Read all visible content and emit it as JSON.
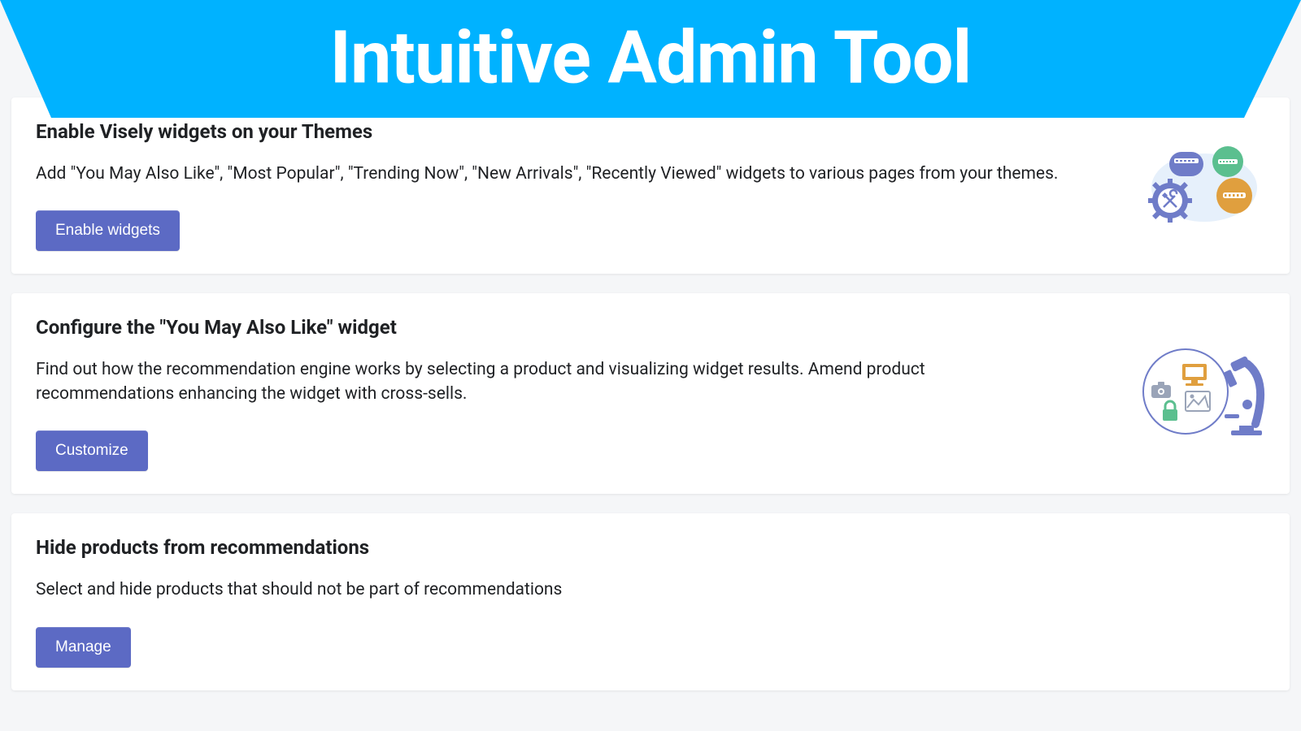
{
  "banner": {
    "title": "Intuitive Admin Tool"
  },
  "cards": [
    {
      "title": "Enable Visely widgets on your Themes",
      "description": "Add \"You May Also Like\", \"Most Popular\", \"Trending Now\", \"New Arrivals\", \"Recently Viewed\" widgets to various pages from your themes.",
      "button": "Enable widgets"
    },
    {
      "title": "Configure the \"You May Also Like\" widget",
      "description": "Find out how the recommendation engine works by selecting a product and visualizing widget results. Amend product recommendations enhancing the widget with cross-sells.",
      "button": "Customize"
    },
    {
      "title": "Hide products from recommendations",
      "description": "Select and hide products that should not be part of recommendations",
      "button": "Manage"
    }
  ]
}
